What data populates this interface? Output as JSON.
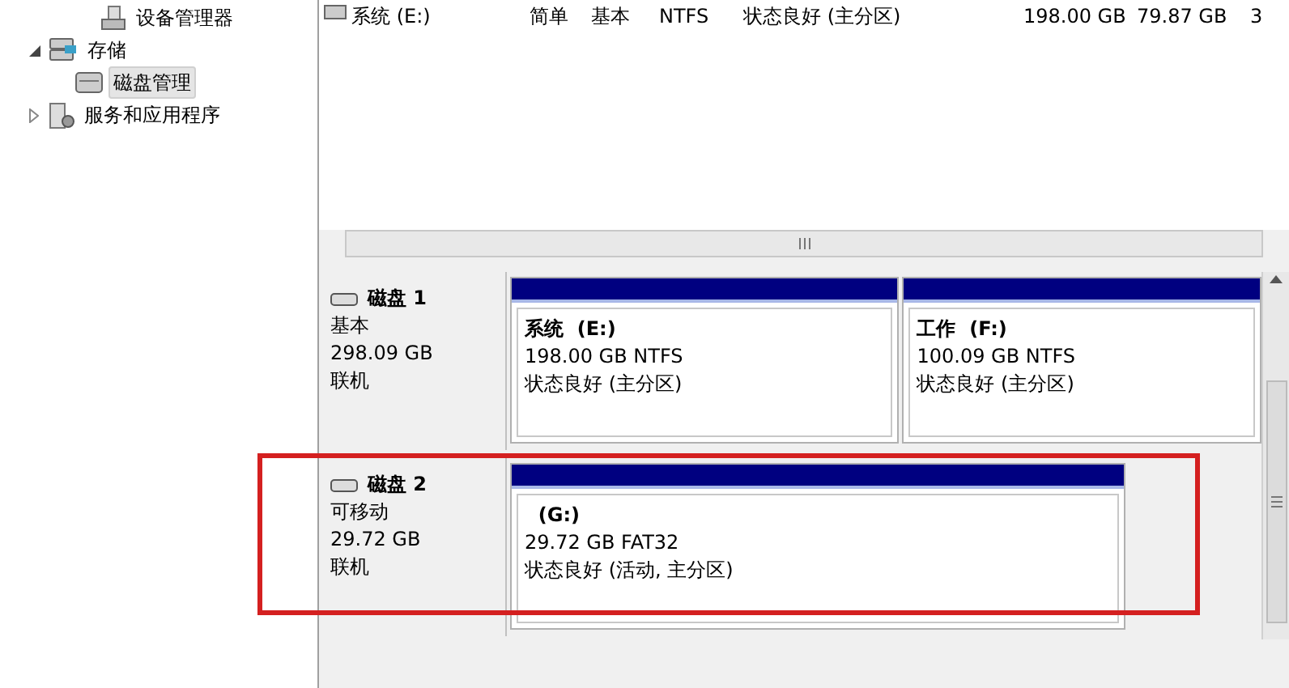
{
  "tree": [
    {
      "children": [
        {
          "label": "设备管理器",
          "kind": "device",
          "selected": false
        }
      ]
    },
    {
      "label": "存储",
      "kind": "storage",
      "expanded": true,
      "selected": false,
      "children": [
        {
          "label": "磁盘管理",
          "kind": "disk",
          "selected": true
        }
      ]
    },
    {
      "label": "服务和应用程序",
      "kind": "services",
      "expanded": false,
      "selected": false
    }
  ],
  "volume_list": {
    "rows": [
      [
        "系统 (E:)",
        "简单",
        "基本",
        "NTFS",
        "状态良好 (主分区)",
        "198.00 GB",
        "79.87 GB",
        "3"
      ]
    ]
  },
  "disks": [
    {
      "name": "磁盘 1",
      "type": "基本",
      "size": "298.09 GB",
      "status": "联机",
      "highlighted": false,
      "partitions": [
        {
          "label": "系统",
          "drive": "(E:)",
          "info": "198.00 GB NTFS",
          "status": "状态良好 (主分区)"
        },
        {
          "label": "工作",
          "drive": "(F:)",
          "info": "100.09 GB NTFS",
          "status": "状态良好 (主分区)"
        }
      ]
    },
    {
      "name": "磁盘 2",
      "type": "可移动",
      "size": "29.72 GB",
      "status": "联机",
      "highlighted": true,
      "partitions": [
        {
          "drive": "(G:)",
          "info": "29.72 GB FAT32",
          "status": "状态良好 (活动, 主分区)"
        }
      ]
    }
  ]
}
